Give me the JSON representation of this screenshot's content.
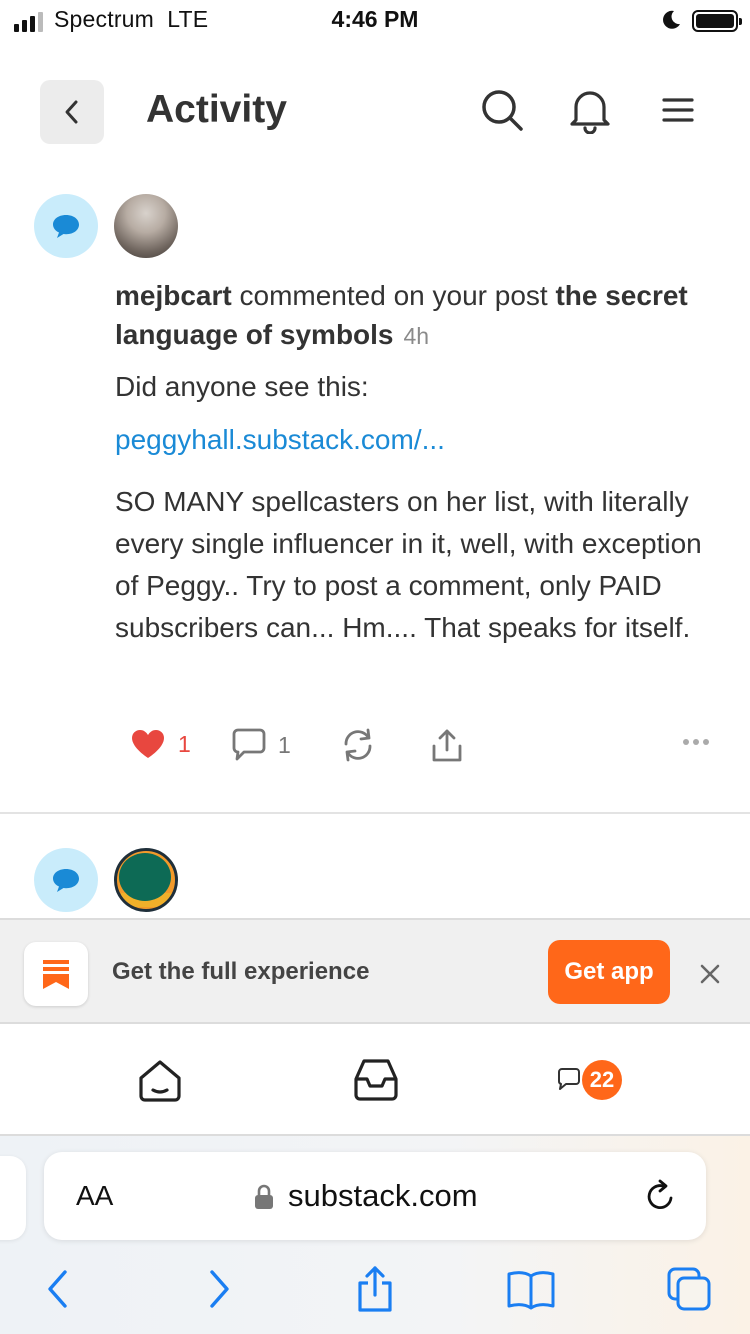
{
  "status_bar": {
    "carrier": "Spectrum",
    "network": "LTE",
    "time": "4:46 PM"
  },
  "header": {
    "title": "Activity",
    "icons": [
      "chevron-left-icon",
      "search-icon",
      "bell-icon",
      "menu-icon"
    ]
  },
  "activity": [
    {
      "actor": "mejbcart",
      "action": "commented on your post",
      "post_title": "the secret language of symbols",
      "time_ago": "4h",
      "comment": {
        "intro": "Did anyone see this:",
        "link": "peggyhall.substack.com/...",
        "body": "SO MANY spellcasters on her list, with literally every single influencer in it, well, with exception of Peggy.. Try to post a comment, only PAID subscribers can... Hm.... That speaks for itself."
      },
      "like_count": "1",
      "reply_count": "1"
    }
  ],
  "banner": {
    "text": "Get the full experience",
    "cta": "Get app"
  },
  "app_nav": {
    "items": [
      "home-icon",
      "inbox-icon",
      "chat-icon"
    ],
    "chat_badge": "22"
  },
  "browser": {
    "aa_label": "AA",
    "url": "substack.com"
  },
  "colors": {
    "accent": "#ff6719",
    "link": "#1a8ad6",
    "like": "#e8473f",
    "badge_bg": "#c9ecfb"
  }
}
